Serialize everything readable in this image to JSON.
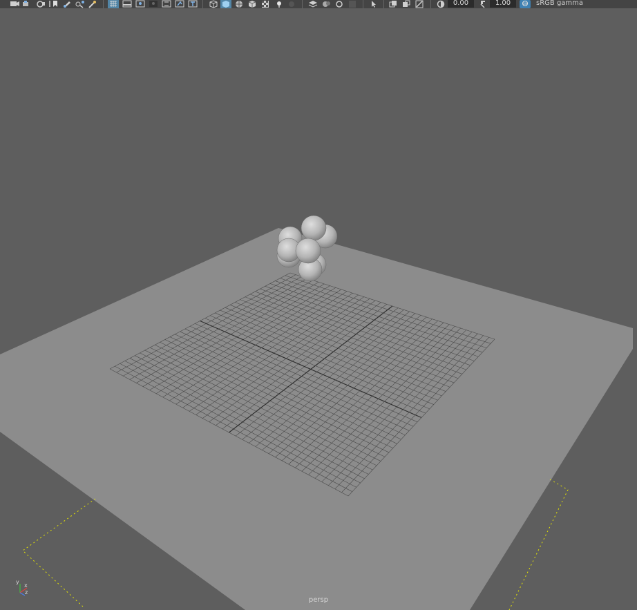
{
  "toolbar": {
    "exposure_value": "0.00",
    "gamma_value": "1.00",
    "color_management_label": "sRGB gamma",
    "icons": [
      "camera-select-icon",
      "camera-attributes-icon",
      "bookmarks-icon",
      "image-plane-icon",
      "view-bookmark-icon",
      "grease-pencil-icon",
      "2d-pan-zoom-icon",
      "snap-icon",
      "grid-icon",
      "film-gate-icon",
      "resolution-gate-icon",
      "gate-mask-icon",
      "field-chart-icon",
      "safe-action-icon",
      "safe-title-icon",
      "wireframe-icon",
      "smooth-shade-icon",
      "wireframe-on-shaded-icon",
      "default-material-icon",
      "textured-icon",
      "use-all-lights-icon",
      "shadows-icon",
      "screen-space-ao-icon",
      "motion-blur-icon",
      "multisample-aa-icon",
      "depth-of-field-icon",
      "isolate-select-icon",
      "xray-icon",
      "xray-joints-icon",
      "xray-components-icon",
      "exposure-icon",
      "gamma-icon",
      "color-management-icon"
    ]
  },
  "viewport": {
    "camera_label": "persp",
    "axis_labels": {
      "x": "x",
      "y": "y",
      "z": "z"
    },
    "background_color": "#5e5e5e",
    "ground_plane_color": "#8c8c8c",
    "grid_line_color": "#4a4a4a",
    "resolution_gate_color": "#e8e800",
    "sphere_count": 8
  }
}
